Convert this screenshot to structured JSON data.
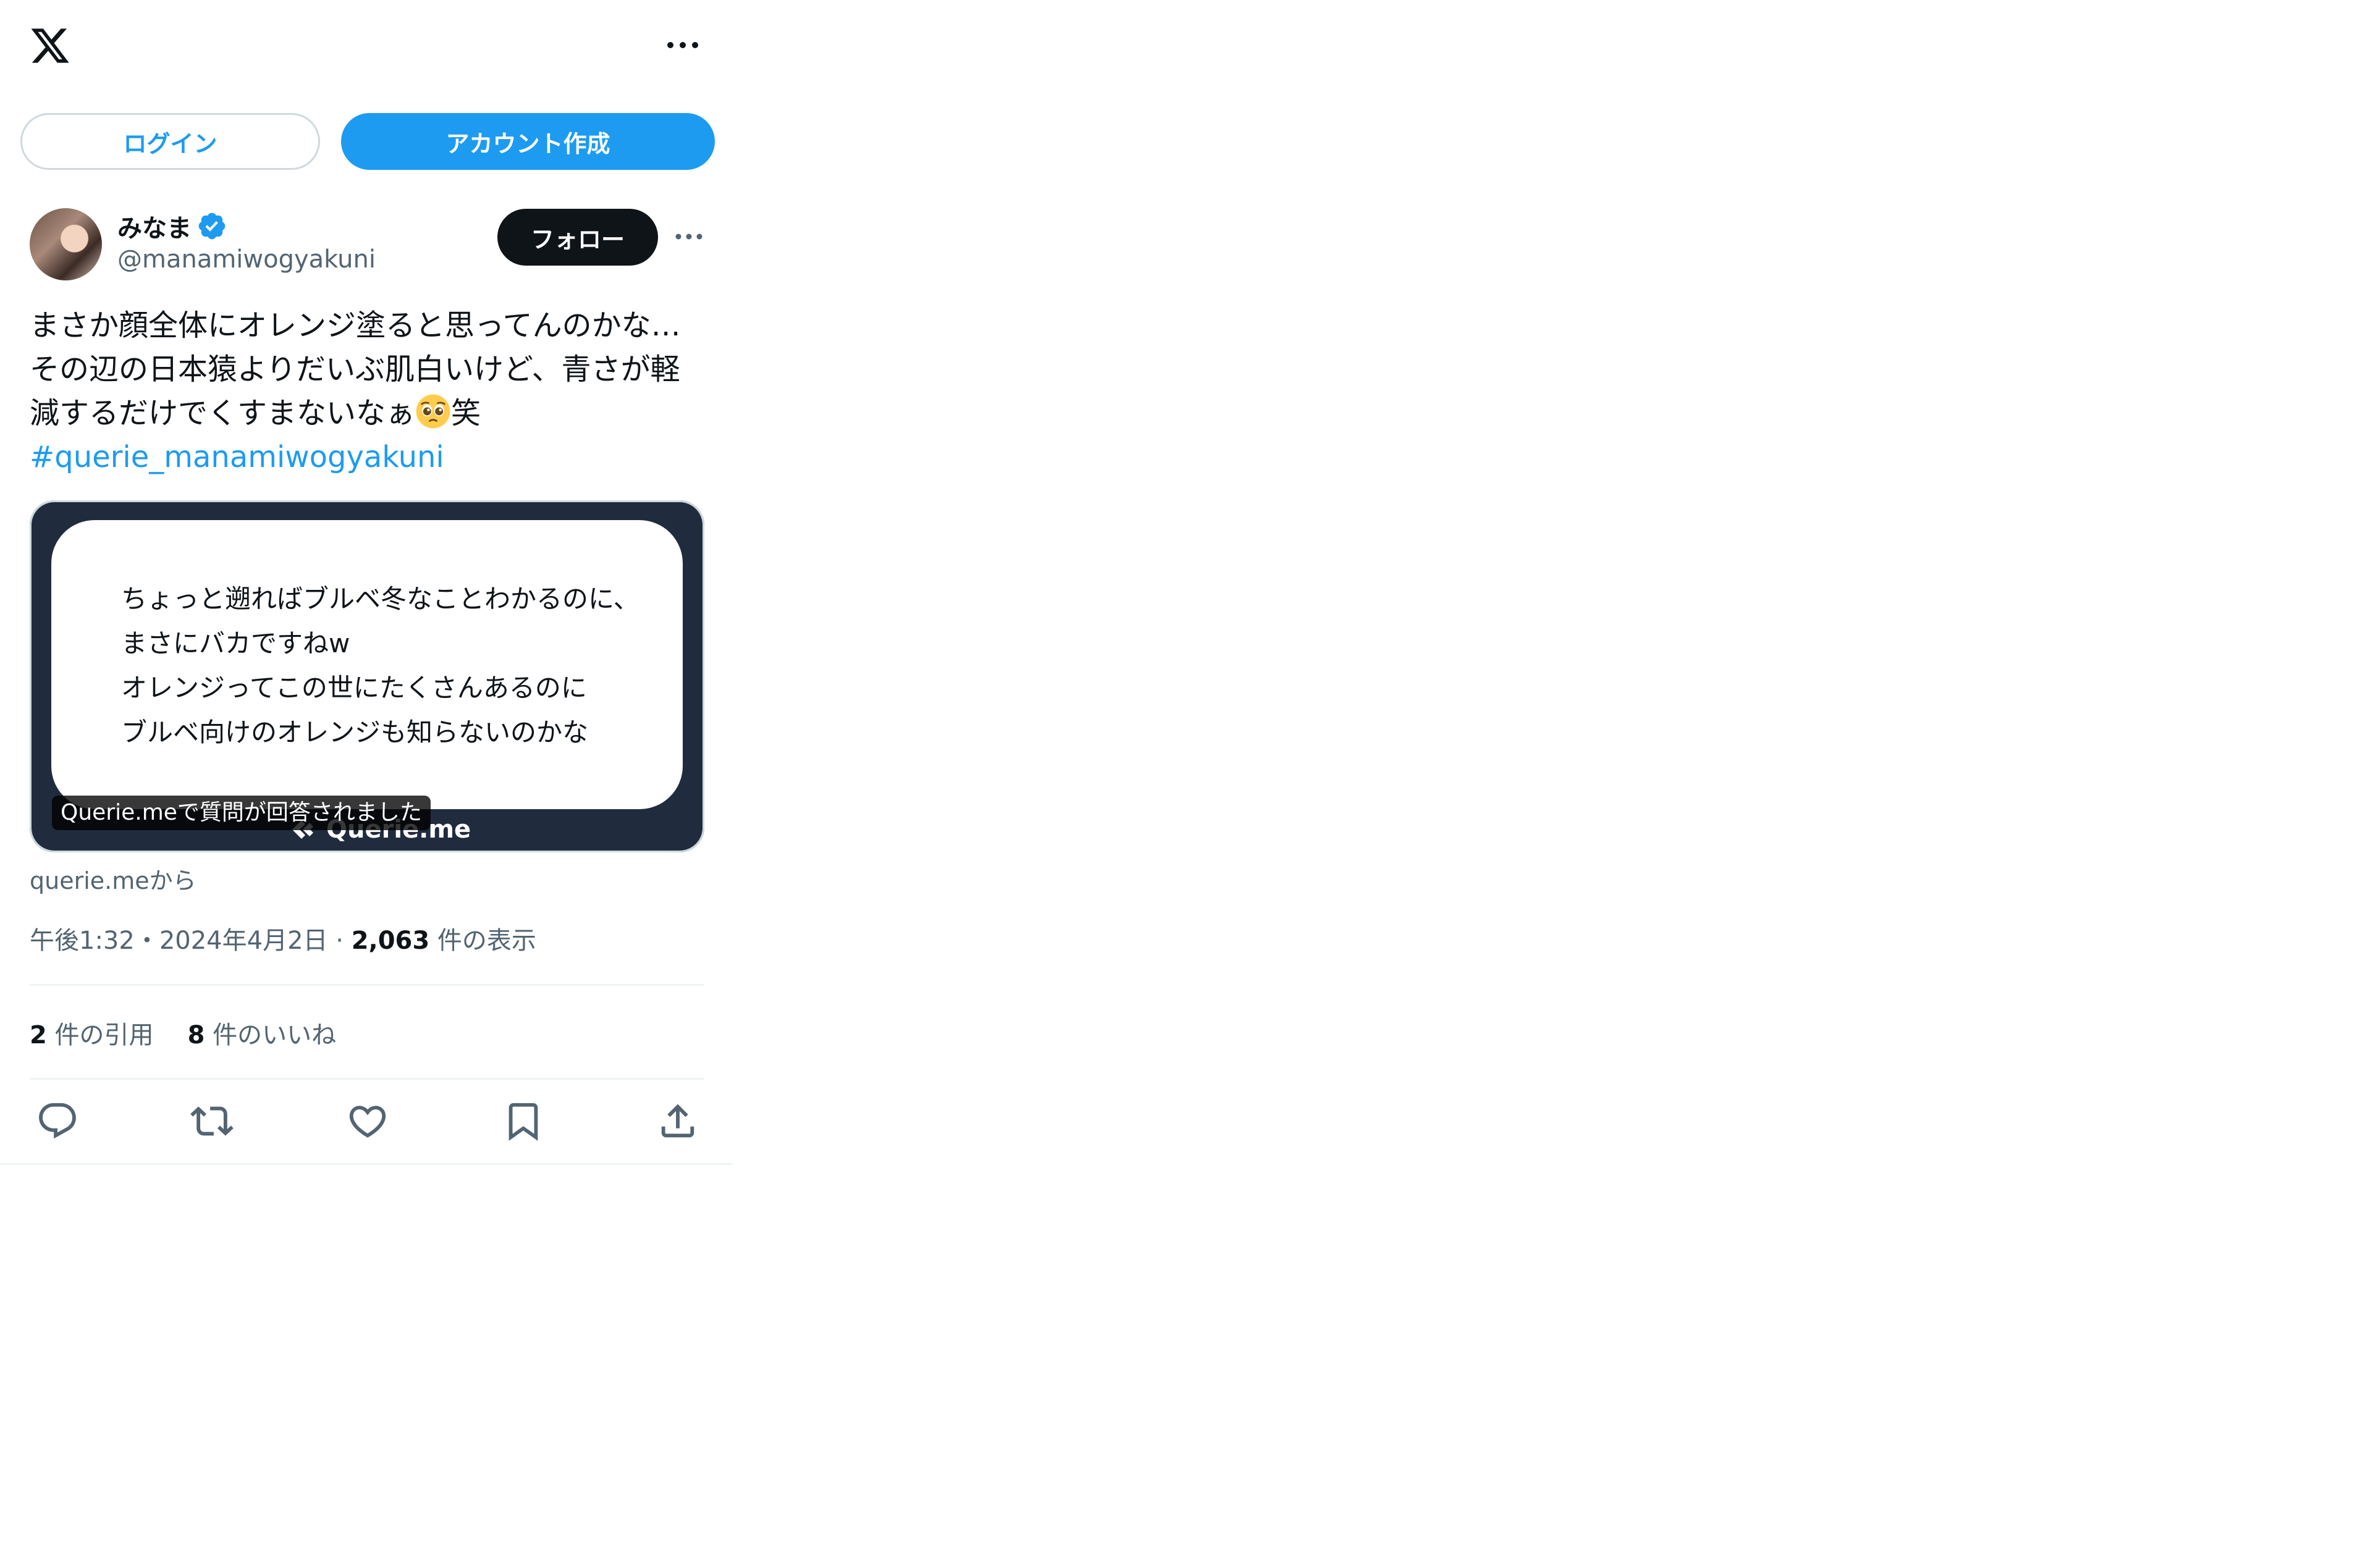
{
  "header": {
    "logo_icon": "x-logo-icon",
    "more_icon": "more-horizontal-icon"
  },
  "auth": {
    "login_label": "ログイン",
    "signup_label": "アカウント作成"
  },
  "author": {
    "display_name": "みなま",
    "handle": "@manamiwogyakuni",
    "verified": true,
    "follow_label": "フォロー"
  },
  "tweet": {
    "lines": [
      "まさか顔全体にオレンジ塗ると思ってんのかな…",
      "その辺の日本猿よりだいぶ肌白いけど、青さが軽",
      "減するだけでくすまないなぁ",
      "笑"
    ],
    "emoji_name": "pleading-face-emoji",
    "hashtag": "#querie_manamiwogyakuni"
  },
  "card": {
    "lines": [
      "ちょっと遡ればブルベ冬なことわかるのに、",
      "まさにバカですねw",
      "オレンジってこの世にたくさんあるのに",
      "ブルベ向けのオレンジも知らないのかな"
    ],
    "brand": "Querie.me",
    "badge": "Querie.meで質問が回答されました"
  },
  "source": "querie.meから",
  "meta": {
    "time": "午後1:32",
    "sep": "・",
    "date": "2024年4月2日",
    "sep2": " · ",
    "views_count": "2,063",
    "views_label": " 件の表示"
  },
  "stats": {
    "quotes_count": "2",
    "quotes_label": " 件の引用",
    "likes_count": "8",
    "likes_label": " 件のいいね"
  },
  "actions": [
    "reply-icon",
    "retweet-icon",
    "like-icon",
    "bookmark-icon",
    "share-icon"
  ],
  "colors": {
    "accent": "#1d9bf0",
    "text": "#0f1419",
    "secondary": "#536471",
    "card_bg": "#202b3e"
  }
}
